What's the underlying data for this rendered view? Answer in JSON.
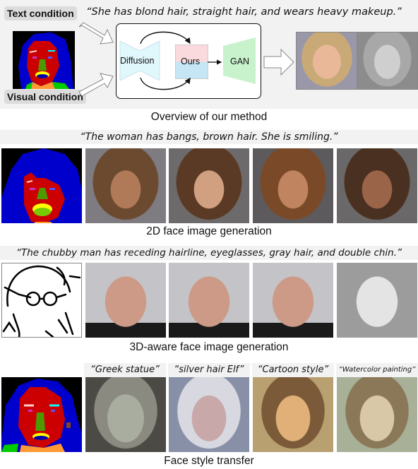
{
  "overview": {
    "text_condition_label": "Text condition",
    "visual_condition_label": "Visual condition",
    "prompt": "“She has blond hair, straight hair, and wears heavy makeup.”",
    "pipeline": {
      "diffusion_label": "Diffusion",
      "ours_label": "Ours",
      "gan_label": "GAN"
    },
    "outputs": [
      "generated-face-photo",
      "generated-face-3d-render"
    ],
    "caption": "Overview of our method"
  },
  "rows": [
    {
      "id": "2d",
      "prompt": "“The woman has bangs, brown hair. She is smiling.”",
      "condition": "segmentation-mask",
      "results": [
        "result-1",
        "result-2",
        "result-3",
        "result-4"
      ],
      "caption": "2D face image generation"
    },
    {
      "id": "3d",
      "prompt": "“The chubby man has receding hairline, eyeglasses, gray hair, and double chin.”",
      "condition": "sketch",
      "results": [
        "view-1",
        "view-2",
        "view-3",
        "3d-render"
      ],
      "caption": "3D-aware face image generation"
    },
    {
      "id": "style",
      "styles": [
        "“Greek statue”",
        "“silver hair Elf”",
        "“Cartoon style”",
        "“Watercolor painting”"
      ],
      "condition": "segmentation-mask",
      "results": [
        "greek-statue",
        "silver-hair-elf",
        "cartoon",
        "watercolor"
      ],
      "caption": "Face style transfer"
    }
  ],
  "colors": {
    "mask_hair": "#0000cc",
    "mask_skin": "#cc0000",
    "mask_nose": "#4c9900",
    "mask_neck": "#ff9933",
    "mask_cloth": "#00cc00",
    "diffusion_fill": "#e0f7fb",
    "ours_top": "#fadadd",
    "ours_bottom": "#c6e6f5",
    "gan_fill": "#c8f2cc"
  }
}
